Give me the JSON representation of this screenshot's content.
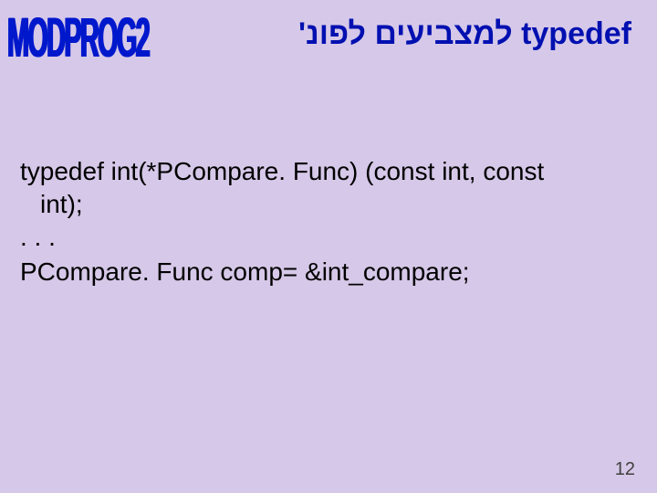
{
  "logo": "MODPROG2",
  "title_full": "typedef למצביעים לפונ'",
  "code": {
    "line1": "typedef int(*PCompare. Func) (const int, const",
    "line2": "int);",
    "line3": ". . .",
    "line4": "PCompare. Func comp= &int_compare;"
  },
  "page_number": "12"
}
